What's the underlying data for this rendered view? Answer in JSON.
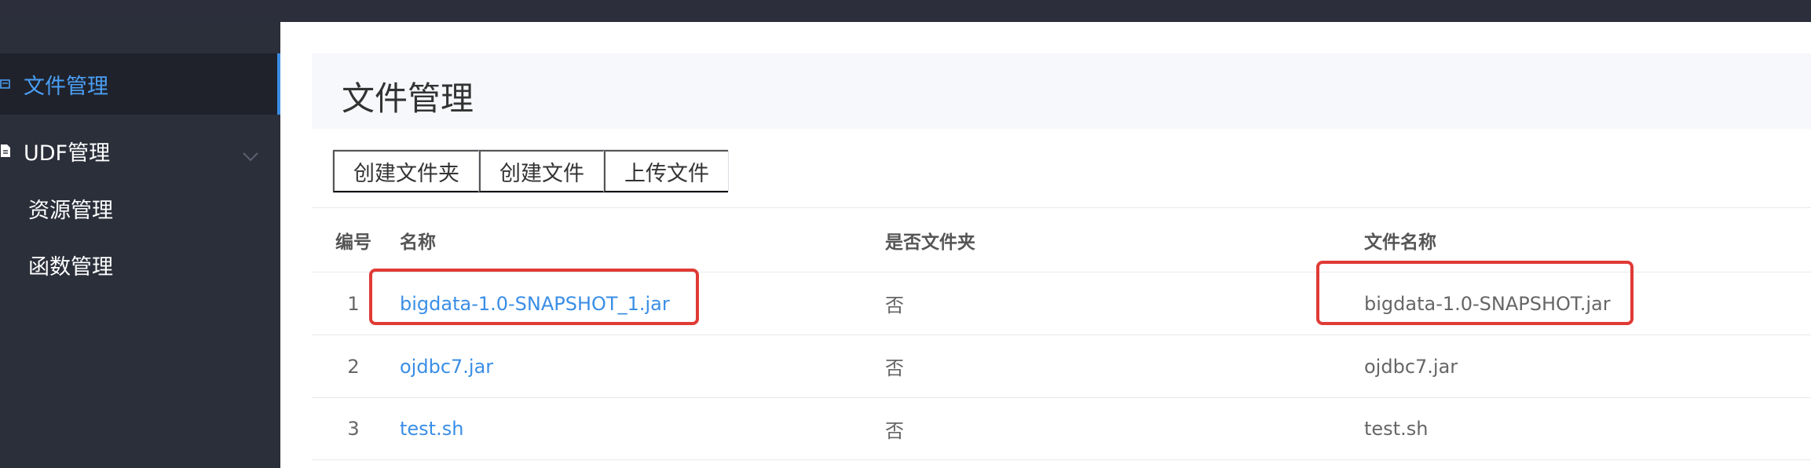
{
  "sidebar": {
    "items": [
      {
        "label": "文件管理",
        "icon": "folder-icon",
        "active": true
      },
      {
        "label": "UDF管理",
        "icon": "file-icon",
        "expanded": true,
        "children": [
          {
            "label": "资源管理"
          },
          {
            "label": "函数管理"
          }
        ]
      }
    ]
  },
  "page": {
    "title": "文件管理"
  },
  "toolbar": {
    "create_folder": "创建文件夹",
    "create_file": "创建文件",
    "upload_file": "上传文件"
  },
  "table": {
    "headers": {
      "no": "编号",
      "name": "名称",
      "is_folder": "是否文件夹",
      "file_name": "文件名称"
    },
    "rows": [
      {
        "no": "1",
        "name": "bigdata-1.0-SNAPSHOT_1.jar",
        "is_folder": "否",
        "file_name": "bigdata-1.0-SNAPSHOT.jar"
      },
      {
        "no": "2",
        "name": "ojdbc7.jar",
        "is_folder": "否",
        "file_name": "ojdbc7.jar"
      },
      {
        "no": "3",
        "name": "test.sh",
        "is_folder": "否",
        "file_name": "test.sh"
      }
    ]
  },
  "colors": {
    "accent": "#3a8ee6",
    "sidebar_bg": "#2b2f3a",
    "highlight": "#e03a35"
  }
}
